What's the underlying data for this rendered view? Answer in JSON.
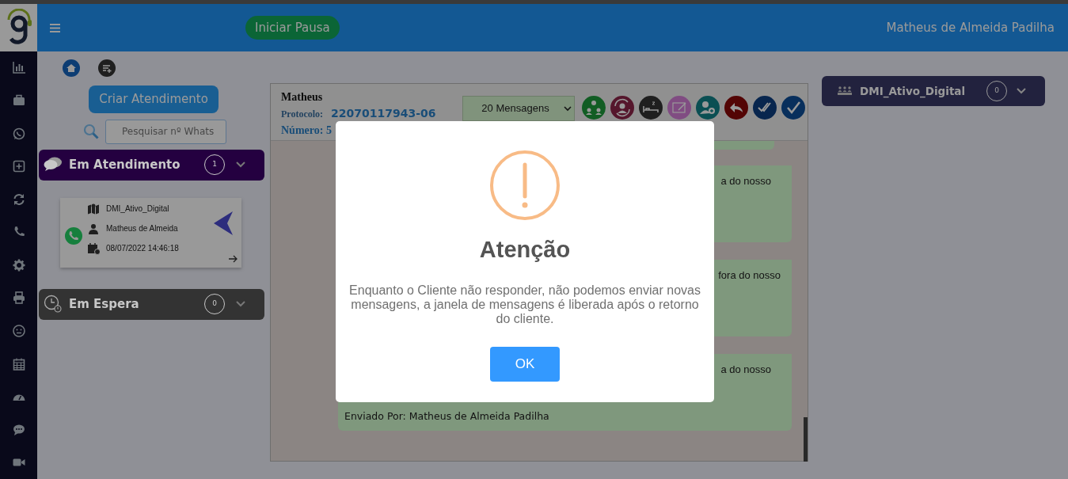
{
  "header": {
    "pause_button": "Iniciar Pausa",
    "user_name": "Matheus de Almeida Padilha"
  },
  "left_panel": {
    "create_button": "Criar Atendimento",
    "search": {
      "placeholder": "Pesquisar nº Whats"
    },
    "queues": [
      {
        "kind": "in_service",
        "title": "Em Atendimento",
        "count": "1",
        "color": "#240040",
        "cards": [
          {
            "queue": "DMI_Ativo_Digital",
            "agent": "Matheus de Almeida",
            "time": "08/07/2022 14:46:18"
          }
        ]
      },
      {
        "kind": "waiting",
        "title": "Em Espera",
        "count": "0",
        "color": "#333333"
      }
    ]
  },
  "chat": {
    "contact": "Matheus",
    "protocol_label": "Protocolo:",
    "protocol": "22070117943-06",
    "number": "Número: 5",
    "messages_filter": "20 Mensagens",
    "messages": [
      {
        "text": "a do nosso"
      },
      {
        "text": "fora do nosso"
      },
      {
        "text": "a do nosso",
        "sender": "Enviado Por: Matheus de Almeida Padilha"
      }
    ]
  },
  "right_panel": {
    "title": "DMI_Ativo_Digital",
    "count": "0"
  },
  "modal": {
    "title": "Atenção",
    "message": "Enquanto o Cliente não responder, não podemos enviar novas mensagens, a janela de mensagens é liberada após o retorno do cliente.",
    "button": "OK"
  }
}
